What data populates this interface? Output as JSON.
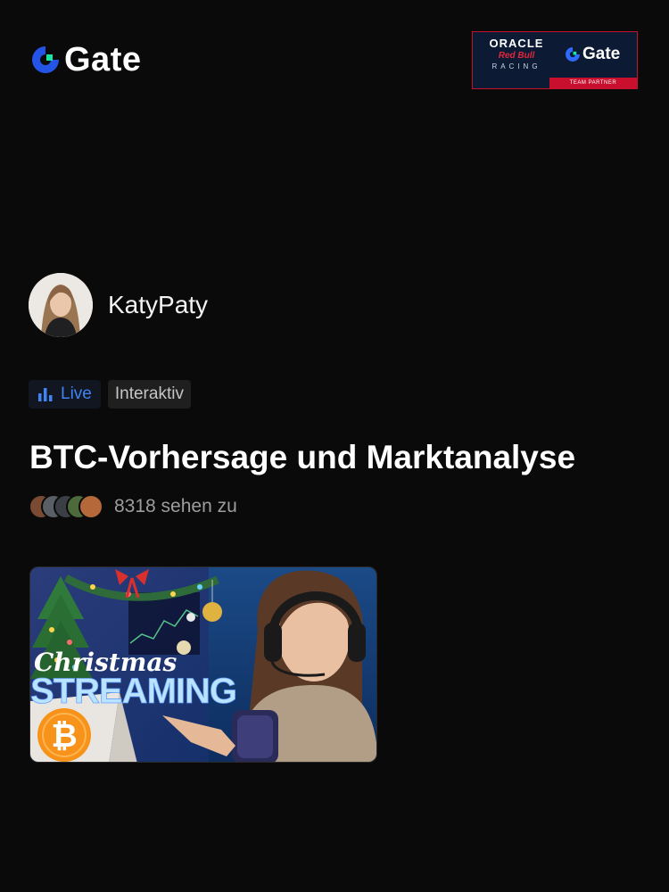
{
  "brand": {
    "name": "Gate",
    "logo_icon": "gate-logo-icon"
  },
  "partner": {
    "line1": "ORACLE",
    "line2": "Red Bull",
    "line3": "RACING",
    "gate": "Gate",
    "strip": "TEAM PARTNER"
  },
  "streamer": {
    "name": "KatyPaty"
  },
  "badges": {
    "live_label": "Live",
    "interactive_label": "Interaktiv"
  },
  "stream": {
    "title": "BTC-Vorhersage und Marktanalyse",
    "viewers_text": "8318 sehen zu"
  },
  "thumbnail": {
    "caption_script": "Christmas",
    "caption_main": "STREAMING",
    "bitcoin_symbol": "₿"
  },
  "colors": {
    "background": "#0a0a0a",
    "accent_blue": "#3f84f5",
    "brand_green": "#17e6a1"
  }
}
